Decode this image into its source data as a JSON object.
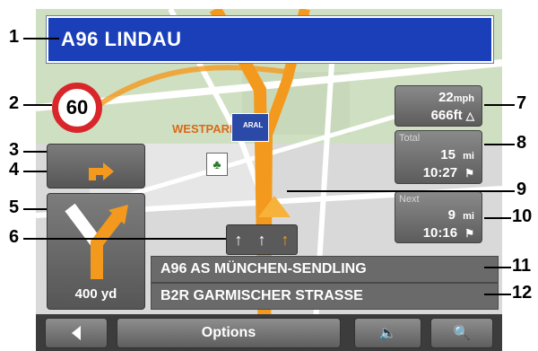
{
  "header": {
    "road_name": "A96 LINDAU"
  },
  "speed_limit": {
    "value": "60"
  },
  "map": {
    "poi_label": "WESTPARK",
    "brand_label": "ARAL"
  },
  "panels": {
    "speed": {
      "value": "22",
      "unit": "mph",
      "distance": "666ft"
    },
    "total": {
      "caption": "Total",
      "distance": "15",
      "unit": "mi",
      "time": "10:27"
    },
    "next": {
      "caption": "Next",
      "distance": "9",
      "unit": "mi",
      "time": "10:16"
    }
  },
  "maneuver": {
    "distance": "400 yd"
  },
  "streets": {
    "current": "A96 AS MÜNCHEN-SENDLING",
    "next": "B2R GARMISCHER STRASSE"
  },
  "toolbar": {
    "options_label": "Options"
  },
  "callouts": [
    "1",
    "2",
    "3",
    "4",
    "5",
    "6",
    "7",
    "8",
    "9",
    "10",
    "11",
    "12"
  ],
  "colors": {
    "route": "#f39a1e",
    "sign_blue": "#1a3fb8",
    "speed_red": "#d8262b"
  }
}
